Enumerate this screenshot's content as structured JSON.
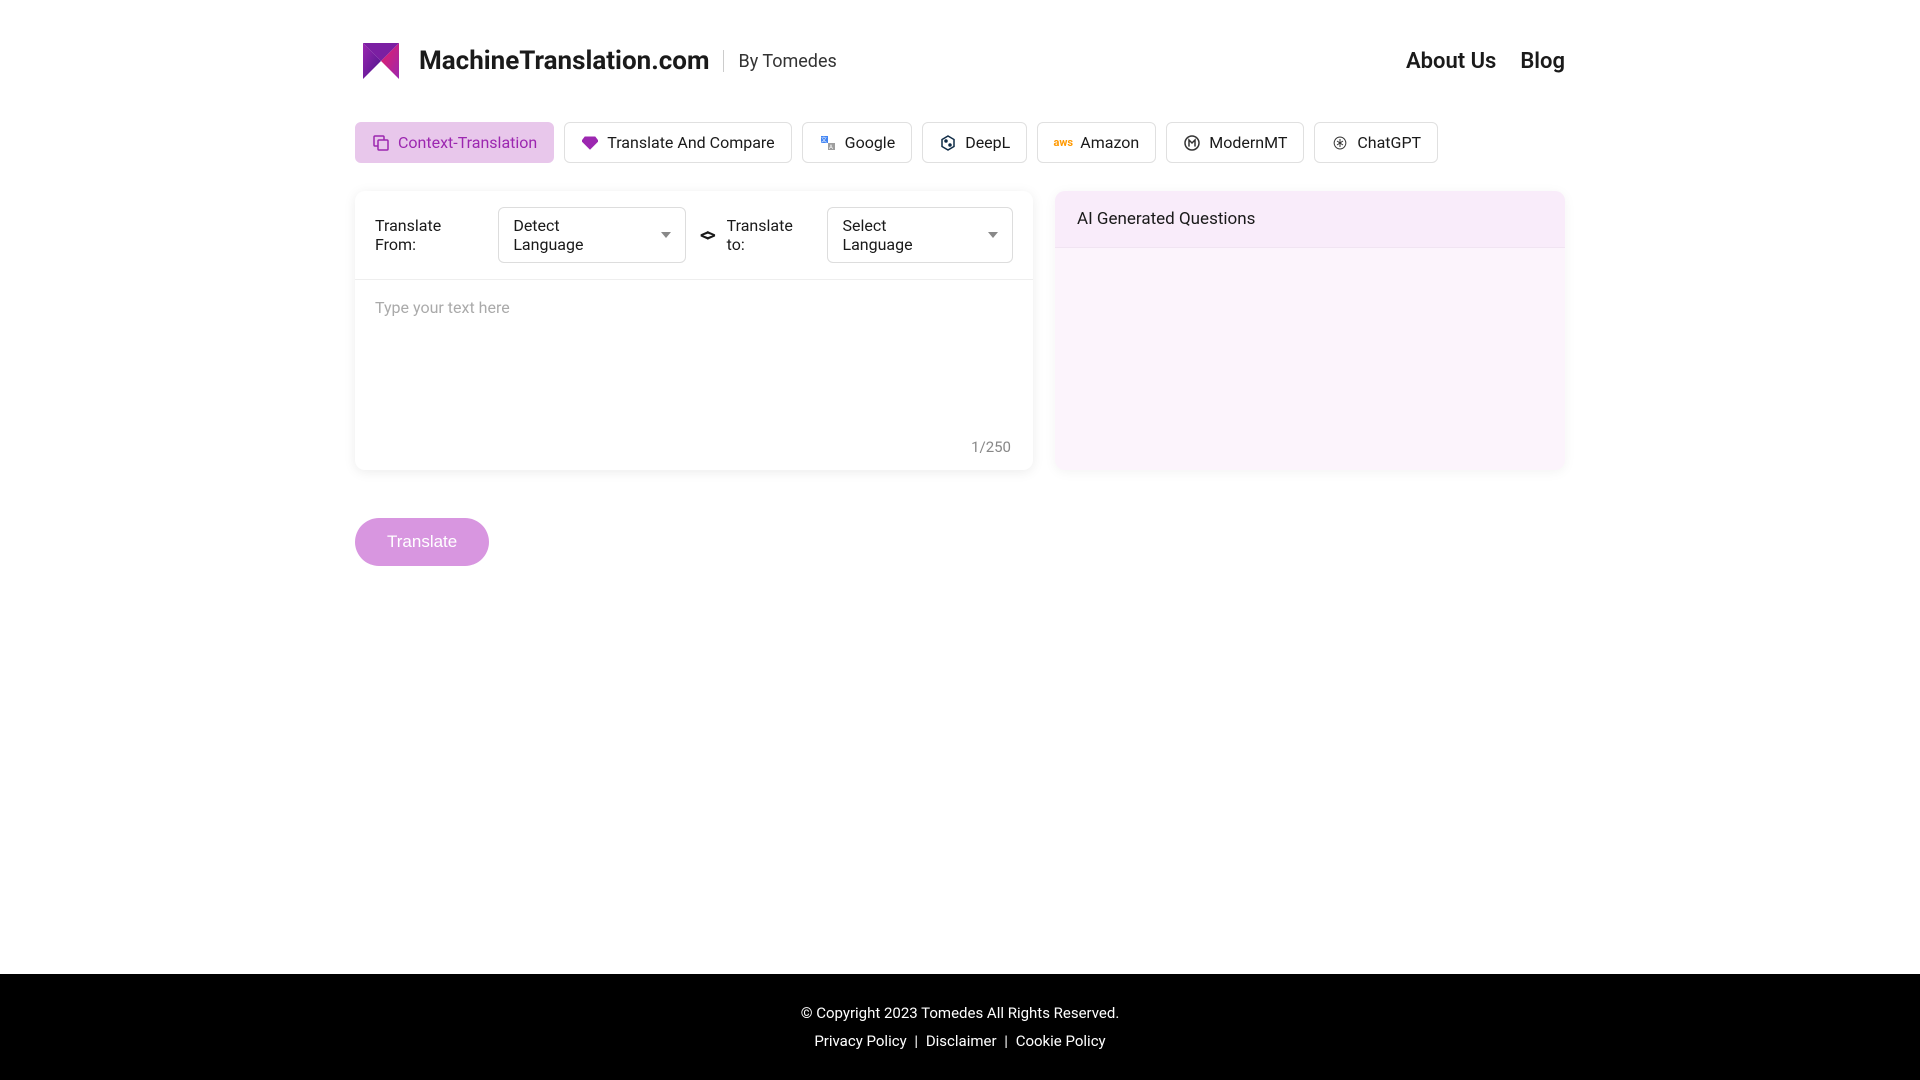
{
  "header": {
    "site_name": "MachineTranslation.com",
    "byline": "By Tomedes",
    "nav": {
      "about": "About Us",
      "blog": "Blog"
    }
  },
  "tabs": {
    "context": "Context-Translation",
    "compare": "Translate And Compare",
    "google": "Google",
    "deepl": "DeepL",
    "amazon": "Amazon",
    "modernmt": "ModernMT",
    "chatgpt": "ChatGPT"
  },
  "translate": {
    "from_label": "Translate From:",
    "from_value": "Detect Language",
    "to_label": "Translate to:",
    "to_value": "Select Language",
    "placeholder": "Type your text here",
    "char_count": "1/250",
    "button": "Translate"
  },
  "questions": {
    "title": "AI Generated Questions"
  },
  "footer": {
    "copyright": "© Copyright 2023 Tomedes All Rights Reserved.",
    "privacy": "Privacy Policy",
    "disclaimer": "Disclaimer",
    "cookie": "Cookie Policy",
    "sep": "|"
  }
}
